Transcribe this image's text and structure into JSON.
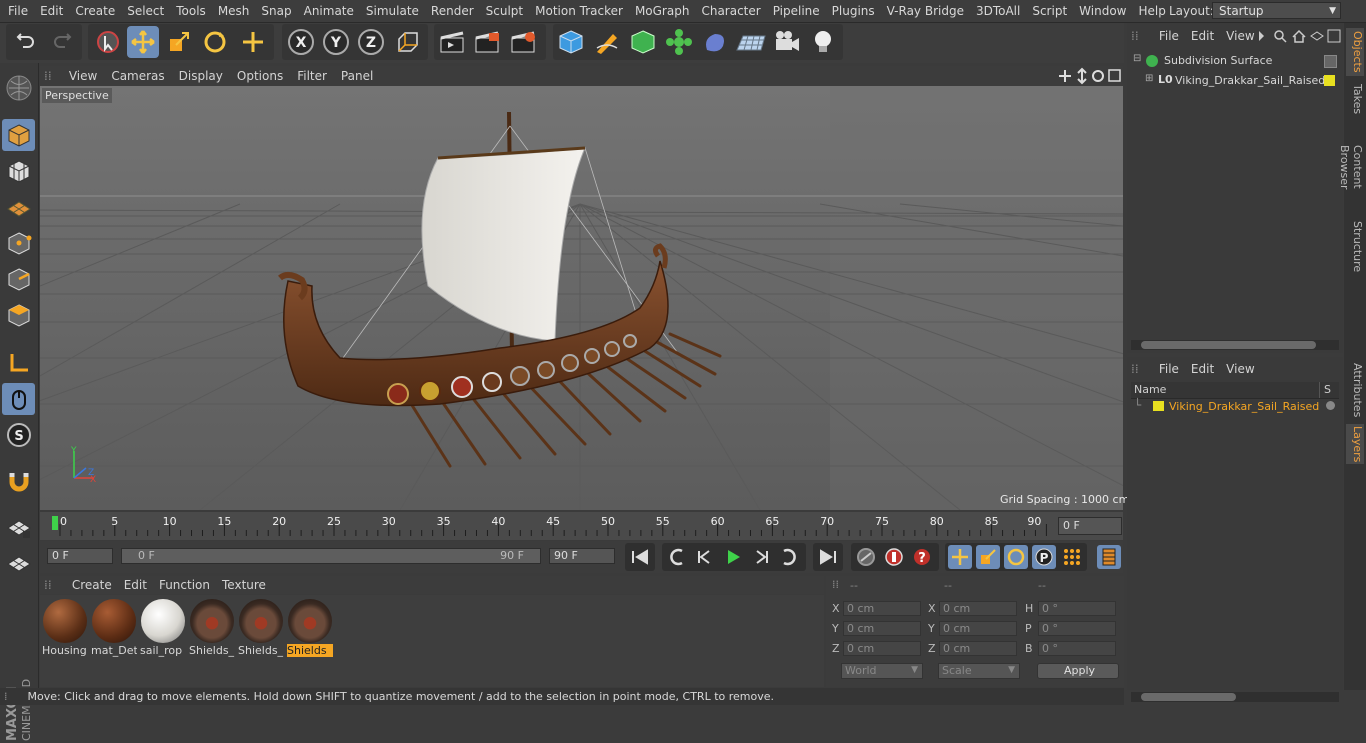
{
  "menu": [
    "File",
    "Edit",
    "Create",
    "Select",
    "Tools",
    "Mesh",
    "Snap",
    "Animate",
    "Simulate",
    "Render",
    "Sculpt",
    "Motion Tracker",
    "MoGraph",
    "Character",
    "Pipeline",
    "Plugins",
    "V-Ray Bridge",
    "3DToAll",
    "Script",
    "Window",
    "Help"
  ],
  "layout": {
    "label": "Layout:",
    "value": "Startup"
  },
  "viewport": {
    "menu": [
      "View",
      "Cameras",
      "Display",
      "Options",
      "Filter",
      "Panel"
    ],
    "camera_label": "Perspective",
    "grid_spacing": "Grid Spacing : 1000 cm"
  },
  "timeline": {
    "ticks": [
      "0",
      "5",
      "10",
      "15",
      "20",
      "25",
      "30",
      "35",
      "40",
      "45",
      "50",
      "55",
      "60",
      "65",
      "70",
      "75",
      "80",
      "85",
      "90"
    ],
    "current_frame": "0 F"
  },
  "transport": {
    "start_field": "0 F",
    "range_start": "0 F",
    "range_end": "90 F",
    "end_field": "90 F"
  },
  "materials": {
    "menu": [
      "Create",
      "Edit",
      "Function",
      "Texture"
    ],
    "items": [
      {
        "label": "Housing",
        "active": false
      },
      {
        "label": "mat_Det",
        "active": false
      },
      {
        "label": "sail_rop",
        "active": false
      },
      {
        "label": "Shields_",
        "active": false
      },
      {
        "label": "Shields_",
        "active": false
      },
      {
        "label": "Shields",
        "active": true
      }
    ]
  },
  "coords": {
    "headers": [
      "--",
      "--",
      "--"
    ],
    "rows": [
      {
        "a": "X",
        "av": "0 cm",
        "b": "X",
        "bv": "0 cm",
        "c": "H",
        "cv": "0 °"
      },
      {
        "a": "Y",
        "av": "0 cm",
        "b": "Y",
        "bv": "0 cm",
        "c": "P",
        "cv": "0 °"
      },
      {
        "a": "Z",
        "av": "0 cm",
        "b": "Z",
        "bv": "0 cm",
        "c": "B",
        "cv": "0 °"
      }
    ],
    "mode1": "World",
    "mode2": "Scale",
    "apply": "Apply"
  },
  "status": "Move: Click and drag to move elements. Hold down SHIFT to quantize movement / add to the selection in point mode, CTRL to remove.",
  "objects": {
    "menu": [
      "File",
      "Edit",
      "View"
    ],
    "items": [
      "Subdivision Surface",
      "Viking_Drakkar_Sail_Raised"
    ]
  },
  "layers": {
    "menu": [
      "File",
      "Edit",
      "View"
    ],
    "col_name": "Name",
    "col_s": "S",
    "items": [
      "Viking_Drakkar_Sail_Raised"
    ]
  },
  "side_tabs": [
    "Objects",
    "Takes",
    "Content Browser",
    "Structure",
    "Attributes",
    "Layers"
  ],
  "colors": {
    "accent": "#6d8db8",
    "highlight": "#f5a623",
    "layer_yellow": "#e8e020"
  }
}
